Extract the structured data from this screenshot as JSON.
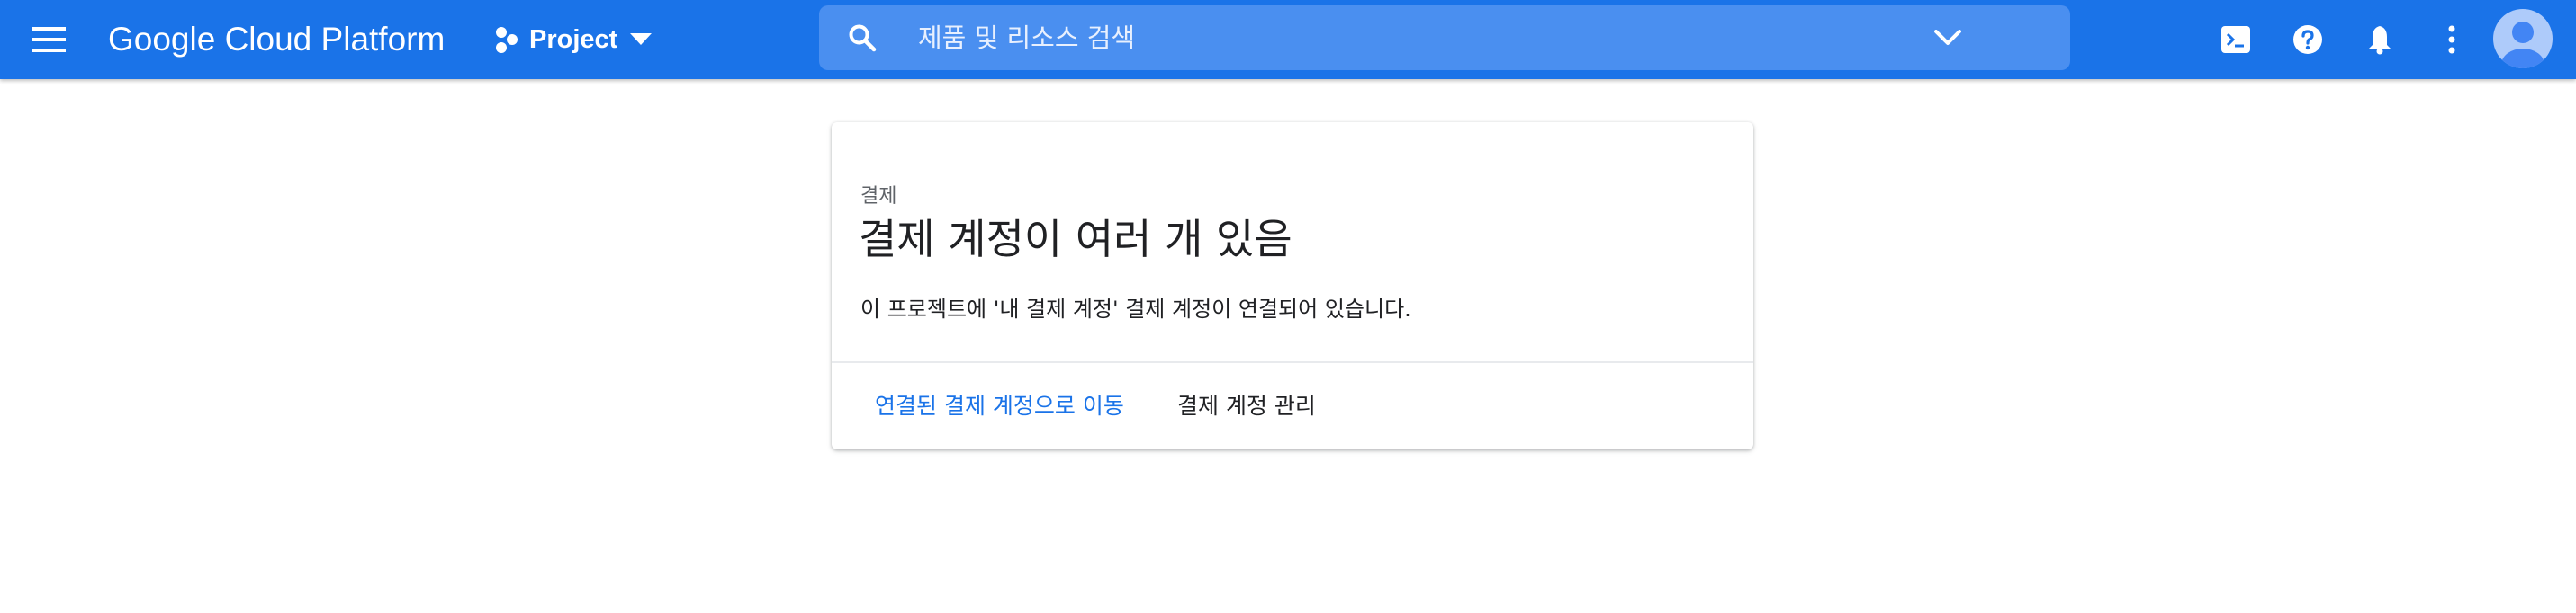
{
  "header": {
    "brand": "Google Cloud Platform",
    "project_label": "Project",
    "search_placeholder": "제품 및 리소스 검색"
  },
  "card": {
    "eyebrow": "결제",
    "title": "결제 계정이 여러 개 있음",
    "description": "이 프로젝트에 '내 결제 계정' 결제 계정이 연결되어 있습니다.",
    "actions": {
      "primary_label": "연결된 결제 계정으로 이동",
      "secondary_label": "결제 계정 관리"
    }
  },
  "colors": {
    "header_bg": "#1a73e8",
    "search_bg": "#4a8ff0",
    "link": "#1a73e8",
    "text": "#202124",
    "muted": "#5f6368"
  },
  "icons": {
    "menu": "hamburger-menu-icon",
    "project": "project-dots-icon",
    "project_dropdown": "caret-down-icon",
    "search": "search-icon",
    "search_expand": "chevron-down-icon",
    "cloud_shell": "terminal-icon",
    "help": "help-icon",
    "notifications": "bell-icon",
    "more": "more-vert-icon",
    "account": "avatar"
  }
}
